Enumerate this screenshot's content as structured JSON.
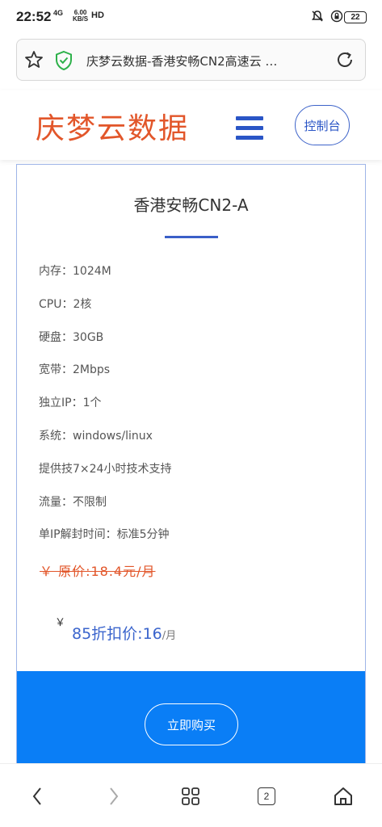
{
  "status_bar": {
    "time": "22:52",
    "network": "4G",
    "speed_value": "6.00",
    "speed_unit": "KB/S",
    "hd": "HD",
    "battery": "22"
  },
  "browser": {
    "page_title": "庆梦云数据-香港安畅CN2高速云 …",
    "tab_count": "2"
  },
  "site": {
    "logo": "庆梦云数据",
    "console_label": "控制台"
  },
  "product": {
    "title": "香港安畅CN2-A",
    "specs": [
      "内存：1024M",
      "CPU：2核",
      "硬盘：30GB",
      "宽带：2Mbps",
      "独立IP：1个",
      "系统：windows/linux",
      "提供技7×24小时技术支持",
      "流量：不限制",
      "单IP解封时间：标准5分钟"
    ],
    "original_price": "￥ 原价:18.4元/月",
    "currency": "￥",
    "discount_label": "85折扣价:16",
    "discount_unit": "/月",
    "buy_label": "立即购买"
  },
  "colors": {
    "accent_blue": "#0a7ef6",
    "brand_orange": "#e2562a",
    "link_blue": "#2a55c6"
  }
}
